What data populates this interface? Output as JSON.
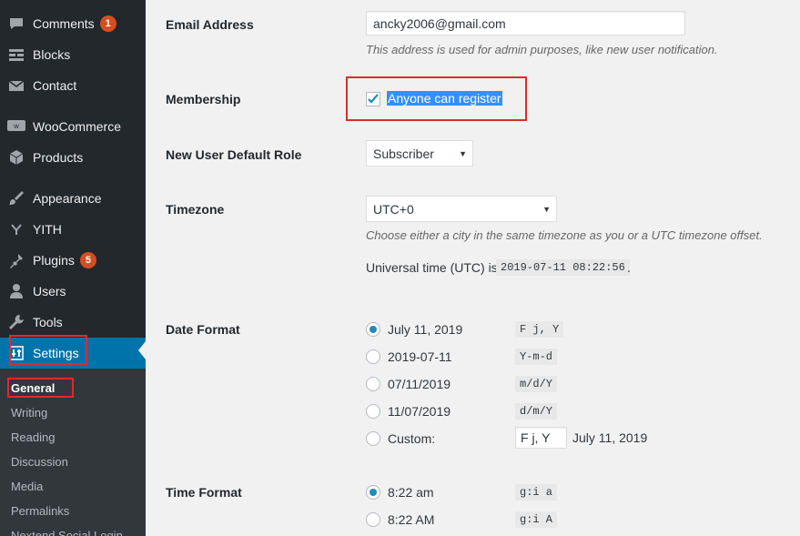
{
  "sidebar": {
    "items": [
      {
        "label": "Comments",
        "icon": "comments-icon",
        "badge": "1"
      },
      {
        "label": "Blocks",
        "icon": "blocks-icon"
      },
      {
        "label": "Contact",
        "icon": "envelope-icon"
      },
      {
        "label": "WooCommerce",
        "icon": "woocommerce-icon"
      },
      {
        "label": "Products",
        "icon": "products-icon"
      },
      {
        "label": "Appearance",
        "icon": "paintbrush-icon"
      },
      {
        "label": "YITH",
        "icon": "yith-icon"
      },
      {
        "label": "Plugins",
        "icon": "plugin-icon",
        "badge": "5"
      },
      {
        "label": "Users",
        "icon": "users-icon"
      },
      {
        "label": "Tools",
        "icon": "wrench-icon"
      },
      {
        "label": "Settings",
        "icon": "settings-icon",
        "active": true
      }
    ],
    "submenu": [
      "General",
      "Writing",
      "Reading",
      "Discussion",
      "Media",
      "Permalinks",
      "Nextend Social Login"
    ]
  },
  "form": {
    "email": {
      "label": "Email Address",
      "value": "ancky2006@gmail.com",
      "description": "This address is used for admin purposes, like new user notification."
    },
    "membership": {
      "label": "Membership",
      "checkbox_label": "Anyone can register",
      "checked": true
    },
    "default_role": {
      "label": "New User Default Role",
      "value": "Subscriber"
    },
    "timezone": {
      "label": "Timezone",
      "value": "UTC+0",
      "description": "Choose either a city in the same timezone as you or a UTC timezone offset.",
      "utc_prefix": "Universal time (UTC) is",
      "utc_value": "2019-07-11 08:22:56",
      "utc_suffix": "."
    },
    "date_format": {
      "label": "Date Format",
      "options": [
        {
          "display": "July 11, 2019",
          "code": "F j, Y",
          "selected": true
        },
        {
          "display": "2019-07-11",
          "code": "Y-m-d"
        },
        {
          "display": "07/11/2019",
          "code": "m/d/Y"
        },
        {
          "display": "11/07/2019",
          "code": "d/m/Y"
        }
      ],
      "custom": {
        "label": "Custom:",
        "value": "F j, Y",
        "preview": "July 11, 2019"
      }
    },
    "time_format": {
      "label": "Time Format",
      "options": [
        {
          "display": "8:22 am",
          "code": "g:i a",
          "selected": true
        },
        {
          "display": "8:22 AM",
          "code": "g:i A"
        }
      ]
    }
  },
  "colors": {
    "sidebar_bg": "#23282d",
    "active_bg": "#0073aa",
    "highlight_box": "#e02b2b",
    "badge": "#d54e21",
    "radio_dot": "#1e8cbe"
  }
}
